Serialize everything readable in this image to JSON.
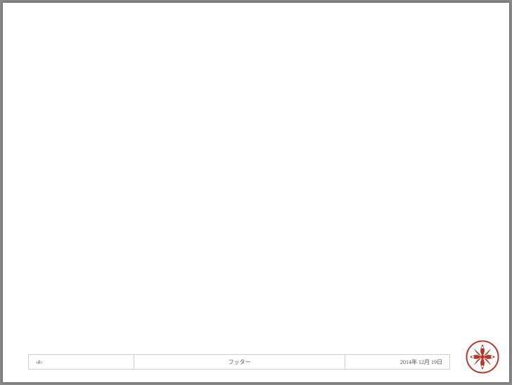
{
  "footer": {
    "page_number_placeholder": "‹#›",
    "center_label": "フッター",
    "date_text": "2014年 12月 19日"
  },
  "branding": {
    "badge_color": "#b43828",
    "badge_name": "red-ornament-seal-icon"
  }
}
